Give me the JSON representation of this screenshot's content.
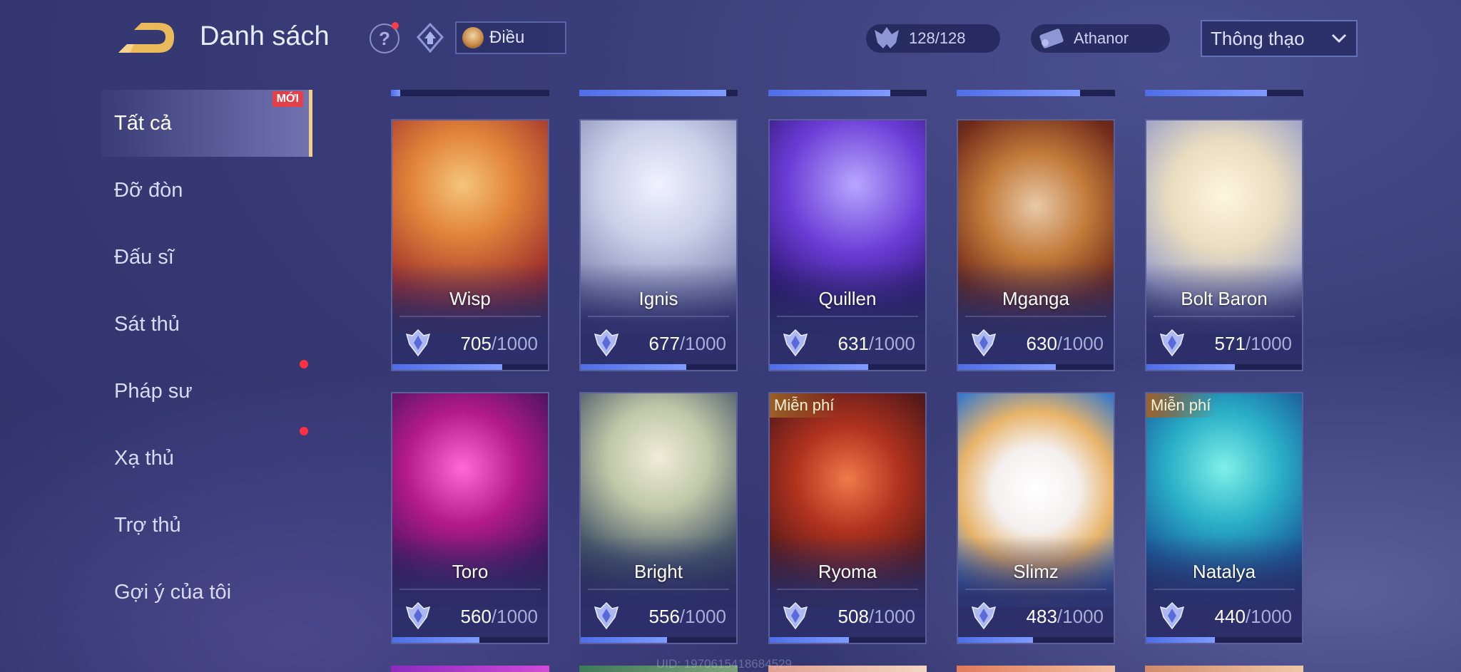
{
  "header": {
    "title": "Danh sách",
    "help_label": "?",
    "player_name": "Điều",
    "trophy_count": "128/128",
    "coin_label": "Athanor",
    "sort_selected": "Thông thạo"
  },
  "sidebar": {
    "items": [
      {
        "label": "Tất cả",
        "active": true,
        "badge": "MỚI"
      },
      {
        "label": "Đỡ đòn"
      },
      {
        "label": "Đấu sĩ"
      },
      {
        "label": "Sát thủ"
      },
      {
        "label": "Pháp sư"
      },
      {
        "label": "Xạ thủ"
      },
      {
        "label": "Trợ thủ"
      },
      {
        "label": "Gợi ý của tôi"
      }
    ]
  },
  "top_row_progress": [
    0.06,
    0.93,
    0.77,
    0.78,
    0.77
  ],
  "heroes": [
    {
      "name": "Wisp",
      "score": "705",
      "max": "/1000",
      "progress": 0.705,
      "free": false
    },
    {
      "name": "Ignis",
      "score": "677",
      "max": "/1000",
      "progress": 0.677,
      "free": false
    },
    {
      "name": "Quillen",
      "score": "631",
      "max": "/1000",
      "progress": 0.631,
      "free": false
    },
    {
      "name": "Mganga",
      "score": "630",
      "max": "/1000",
      "progress": 0.63,
      "free": false
    },
    {
      "name": "Bolt Baron",
      "score": "571",
      "max": "/1000",
      "progress": 0.571,
      "free": false
    },
    {
      "name": "Toro",
      "score": "560",
      "max": "/1000",
      "progress": 0.56,
      "free": false
    },
    {
      "name": "Bright",
      "score": "556",
      "max": "/1000",
      "progress": 0.556,
      "free": false
    },
    {
      "name": "Ryoma",
      "score": "508",
      "max": "/1000",
      "progress": 0.508,
      "free": true
    },
    {
      "name": "Slimz",
      "score": "483",
      "max": "/1000",
      "progress": 0.483,
      "free": false
    },
    {
      "name": "Natalya",
      "score": "440",
      "max": "/1000",
      "progress": 0.44,
      "free": true
    }
  ],
  "free_label": "Miễn phí",
  "uid_text": "UID: 1970615418684529",
  "colors": {
    "accent_gold": "#f2d08a",
    "progress_blue": "#5a7cf0",
    "badge_red": "#e4404a"
  }
}
